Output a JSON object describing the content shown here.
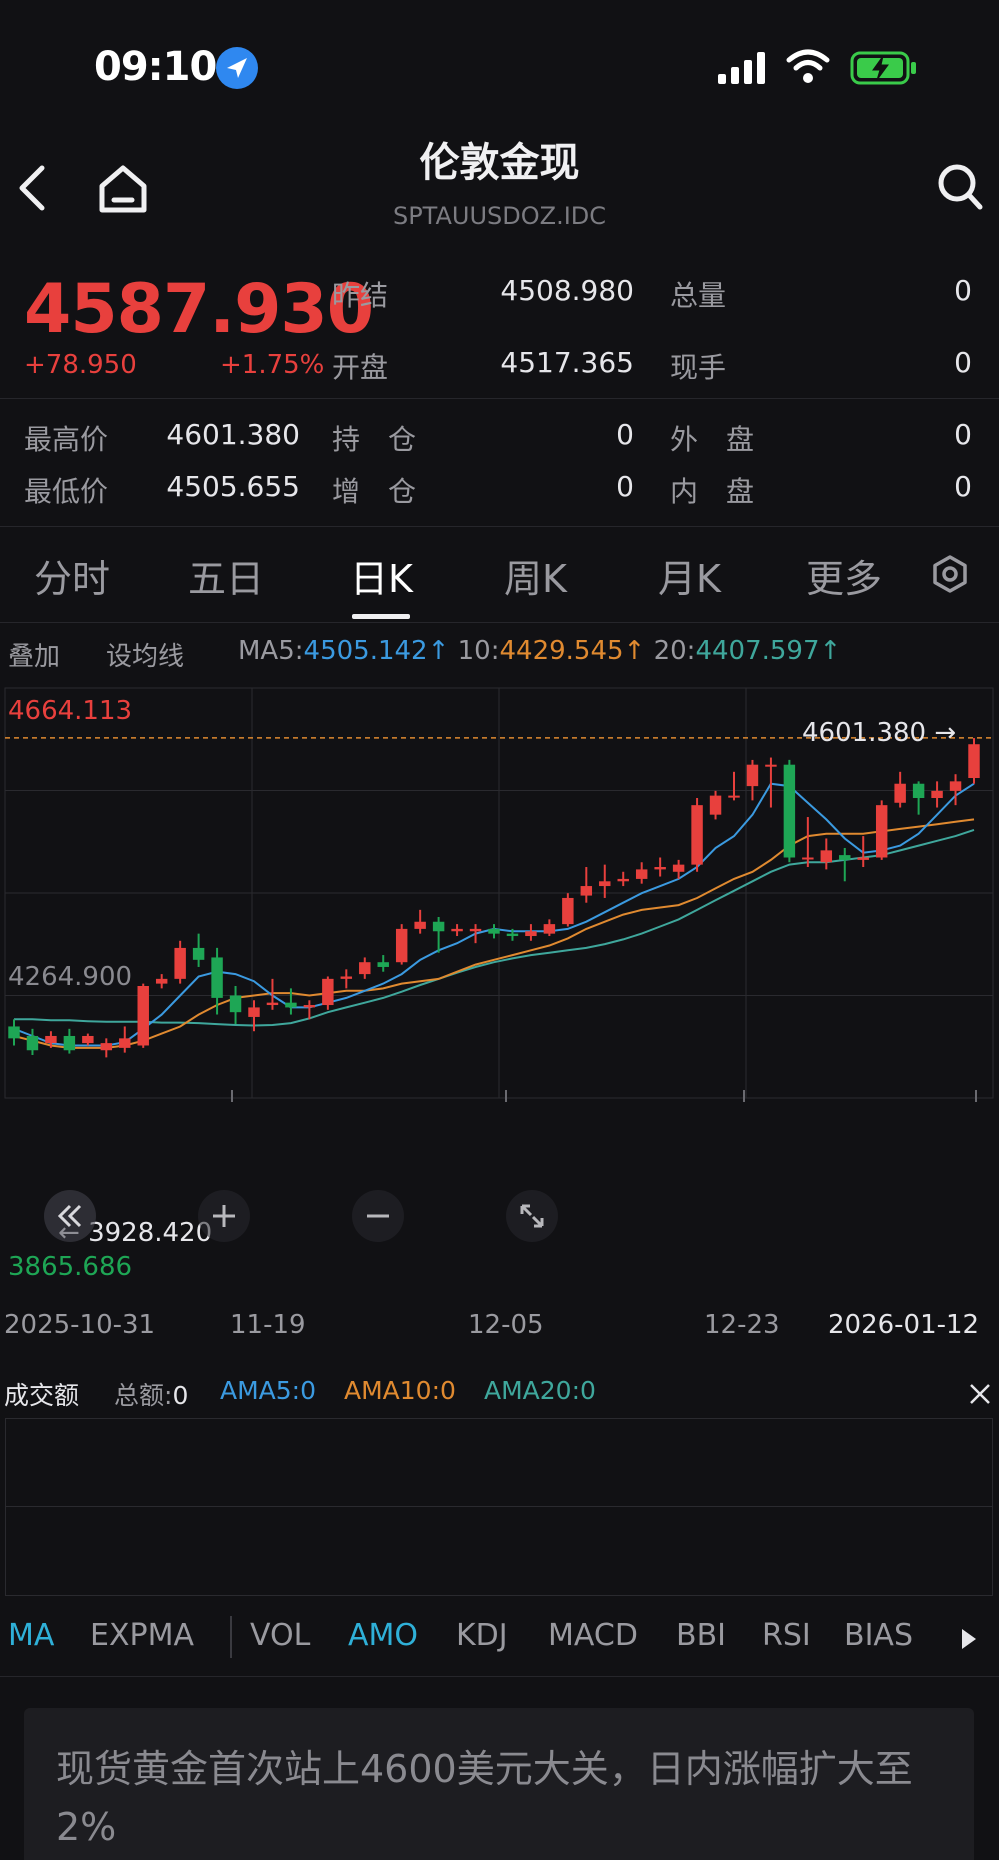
{
  "status_bar": {
    "time": "09:10"
  },
  "nav": {
    "title": "伦敦金现",
    "symbol": "SPTAUUSDOZ.IDC"
  },
  "quote": {
    "price": "4587.930",
    "change": "+78.950",
    "change_pct": "+1.75%",
    "prev_settle_label": "昨结",
    "prev_settle": "4508.980",
    "total_vol_label": "总量",
    "total_vol": "0",
    "open_label": "开盘",
    "open": "4517.365",
    "current_hand_label": "现手",
    "current_hand": "0",
    "high_label": "最高价",
    "high": "4601.380",
    "position_label": "持　仓",
    "position": "0",
    "outer_label": "外　盘",
    "outer": "0",
    "low_label": "最低价",
    "low": "4505.655",
    "add_pos_label": "增　仓",
    "add_pos": "0",
    "inner_label": "内　盘",
    "inner": "0"
  },
  "tabs": [
    "分时",
    "五日",
    "日K",
    "周K",
    "月K",
    "更多"
  ],
  "ma_bar": {
    "overlay": "叠加",
    "set_ma": "设均线",
    "ma5_label": "MA5:",
    "ma5": "4505.142↑",
    "ma10_label": "10:",
    "ma10": "4429.545↑",
    "ma20_label": "20:",
    "ma20": "4407.597↑"
  },
  "colors": {
    "up": "#e8403d",
    "down": "#1ea655",
    "ma5": "#3b9ae0",
    "ma10": "#e08a30",
    "ma20": "#3fa79c",
    "accent": "#2fb0d8"
  },
  "chart_data": {
    "type": "candlestick",
    "ylim": [
      3865.686,
      4664.113
    ],
    "y_labels": {
      "top": "4664.113",
      "mid": "4264.900",
      "bottom": "3865.686"
    },
    "high_marker": "4601.380",
    "low_marker": "3928.420",
    "x_ticks": [
      "2025-10-31",
      "11-19",
      "12-05",
      "12-23",
      "2026-01-12"
    ],
    "candles": [
      {
        "o": 3995,
        "c": 3970,
        "h": 4010,
        "l": 3955
      },
      {
        "o": 3975,
        "c": 3945,
        "h": 3990,
        "l": 3935
      },
      {
        "o": 3960,
        "c": 3975,
        "h": 3985,
        "l": 3950
      },
      {
        "o": 3975,
        "c": 3945,
        "h": 3990,
        "l": 3938
      },
      {
        "o": 3960,
        "c": 3975,
        "h": 3980,
        "l": 3955
      },
      {
        "o": 3945,
        "c": 3960,
        "h": 3970,
        "l": 3930
      },
      {
        "o": 3950,
        "c": 3970,
        "h": 3995,
        "l": 3940
      },
      {
        "o": 3955,
        "c": 4080,
        "h": 4085,
        "l": 3950
      },
      {
        "o": 4085,
        "c": 4095,
        "h": 4105,
        "l": 4075
      },
      {
        "o": 4095,
        "c": 4160,
        "h": 4175,
        "l": 4085
      },
      {
        "o": 4160,
        "c": 4135,
        "h": 4190,
        "l": 4120
      },
      {
        "o": 4140,
        "c": 4055,
        "h": 4160,
        "l": 4020
      },
      {
        "o": 4060,
        "c": 4025,
        "h": 4080,
        "l": 4000
      },
      {
        "o": 4015,
        "c": 4035,
        "h": 4050,
        "l": 3985
      },
      {
        "o": 4040,
        "c": 4045,
        "h": 4095,
        "l": 4030
      },
      {
        "o": 4045,
        "c": 4035,
        "h": 4075,
        "l": 4020
      },
      {
        "o": 4035,
        "c": 4040,
        "h": 4050,
        "l": 4010
      },
      {
        "o": 4040,
        "c": 4095,
        "h": 4100,
        "l": 4030
      },
      {
        "o": 4095,
        "c": 4100,
        "h": 4115,
        "l": 4075
      },
      {
        "o": 4105,
        "c": 4130,
        "h": 4140,
        "l": 4095
      },
      {
        "o": 4130,
        "c": 4120,
        "h": 4145,
        "l": 4110
      },
      {
        "o": 4130,
        "c": 4200,
        "h": 4210,
        "l": 4125
      },
      {
        "o": 4200,
        "c": 4215,
        "h": 4240,
        "l": 4190
      },
      {
        "o": 4215,
        "c": 4195,
        "h": 4225,
        "l": 4150
      },
      {
        "o": 4195,
        "c": 4200,
        "h": 4210,
        "l": 4185
      },
      {
        "o": 4195,
        "c": 4200,
        "h": 4210,
        "l": 4170
      },
      {
        "o": 4200,
        "c": 4190,
        "h": 4210,
        "l": 4180
      },
      {
        "o": 4190,
        "c": 4185,
        "h": 4200,
        "l": 4175
      },
      {
        "o": 4185,
        "c": 4195,
        "h": 4210,
        "l": 4175
      },
      {
        "o": 4190,
        "c": 4210,
        "h": 4220,
        "l": 4185
      },
      {
        "o": 4210,
        "c": 4265,
        "h": 4275,
        "l": 4205
      },
      {
        "o": 4270,
        "c": 4290,
        "h": 4330,
        "l": 4255
      },
      {
        "o": 4290,
        "c": 4300,
        "h": 4335,
        "l": 4265
      },
      {
        "o": 4300,
        "c": 4305,
        "h": 4320,
        "l": 4290
      },
      {
        "o": 4305,
        "c": 4325,
        "h": 4340,
        "l": 4295
      },
      {
        "o": 4325,
        "c": 4330,
        "h": 4350,
        "l": 4310
      },
      {
        "o": 4320,
        "c": 4335,
        "h": 4345,
        "l": 4305
      },
      {
        "o": 4335,
        "c": 4460,
        "h": 4475,
        "l": 4320
      },
      {
        "o": 4440,
        "c": 4480,
        "h": 4490,
        "l": 4430
      },
      {
        "o": 4480,
        "c": 4480,
        "h": 4530,
        "l": 4470
      },
      {
        "o": 4500,
        "c": 4545,
        "h": 4555,
        "l": 4470
      },
      {
        "o": 4545,
        "c": 4545,
        "h": 4560,
        "l": 4455
      },
      {
        "o": 4545,
        "c": 4350,
        "h": 4555,
        "l": 4340
      },
      {
        "o": 4350,
        "c": 4350,
        "h": 4435,
        "l": 4330
      },
      {
        "o": 4340,
        "c": 4365,
        "h": 4390,
        "l": 4325
      },
      {
        "o": 4355,
        "c": 4345,
        "h": 4370,
        "l": 4300
      },
      {
        "o": 4345,
        "c": 4350,
        "h": 4395,
        "l": 4330
      },
      {
        "o": 4350,
        "c": 4460,
        "h": 4470,
        "l": 4345
      },
      {
        "o": 4465,
        "c": 4505,
        "h": 4530,
        "l": 4455
      },
      {
        "o": 4505,
        "c": 4475,
        "h": 4510,
        "l": 4440
      },
      {
        "o": 4475,
        "c": 4490,
        "h": 4510,
        "l": 4455
      },
      {
        "o": 4490,
        "c": 4510,
        "h": 4525,
        "l": 4460
      },
      {
        "o": 4517,
        "c": 4588,
        "h": 4601,
        "l": 4505
      }
    ],
    "ma5": [
      3990,
      3975,
      3960,
      3955,
      3955,
      3955,
      3962,
      3990,
      4020,
      4060,
      4100,
      4110,
      4105,
      4090,
      4060,
      4035,
      4035,
      4045,
      4055,
      4070,
      4085,
      4105,
      4135,
      4155,
      4170,
      4190,
      4200,
      4195,
      4195,
      4195,
      4200,
      4215,
      4235,
      4255,
      4275,
      4290,
      4305,
      4330,
      4370,
      4395,
      4440,
      4505,
      4500,
      4465,
      4430,
      4390,
      4360,
      4365,
      4375,
      4400,
      4440,
      4480,
      4505
    ],
    "ma10": [
      3975,
      3965,
      3955,
      3950,
      3950,
      3950,
      3955,
      3965,
      3980,
      3995,
      4020,
      4040,
      4055,
      4060,
      4065,
      4065,
      4060,
      4065,
      4070,
      4070,
      4075,
      4085,
      4090,
      4095,
      4110,
      4125,
      4135,
      4145,
      4155,
      4165,
      4180,
      4200,
      4215,
      4230,
      4240,
      4245,
      4250,
      4265,
      4285,
      4305,
      4320,
      4345,
      4375,
      4395,
      4400,
      4400,
      4400,
      4405,
      4410,
      4415,
      4420,
      4425,
      4430
    ],
    "ma20": [
      4010,
      4010,
      4008,
      4008,
      4006,
      4005,
      4005,
      4005,
      4003,
      4003,
      4002,
      4000,
      3998,
      3997,
      3998,
      4002,
      4012,
      4025,
      4035,
      4045,
      4055,
      4068,
      4082,
      4095,
      4108,
      4120,
      4130,
      4138,
      4145,
      4150,
      4155,
      4160,
      4168,
      4178,
      4190,
      4205,
      4220,
      4240,
      4260,
      4280,
      4300,
      4320,
      4335,
      4340,
      4340,
      4345,
      4350,
      4355,
      4365,
      4375,
      4385,
      4395,
      4408
    ]
  },
  "volume": {
    "title": "成交额",
    "total_label": "总额:",
    "total": "0",
    "ama5_label": "AMA5:",
    "ama5": "0",
    "ama10_label": "AMA10:",
    "ama10": "0",
    "ama20_label": "AMA20:",
    "ama20": "0"
  },
  "indicators": [
    "MA",
    "EXPMA",
    "VOL",
    "AMO",
    "KDJ",
    "MACD",
    "BBI",
    "RSI",
    "BIAS"
  ],
  "news": {
    "headline": "现货黄金首次站上4600美元大关，日内涨幅扩大至2%"
  }
}
